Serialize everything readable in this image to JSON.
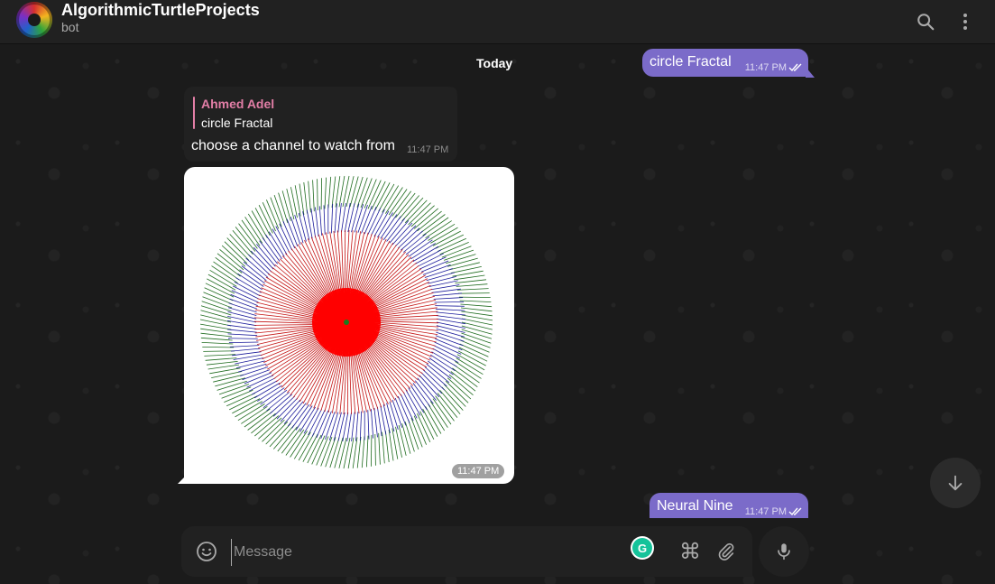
{
  "header": {
    "title": "AlgorithmicTurtleProjects",
    "subtitle": "bot",
    "search_icon": "search-icon",
    "menu_icon": "more-vertical-icon"
  },
  "chat": {
    "date_label": "Today",
    "messages": [
      {
        "type": "outgoing",
        "text": "circle Fractal",
        "time": "11:47 PM"
      },
      {
        "type": "incoming",
        "reply_to": {
          "author": "Ahmed Adel",
          "text": "circle Fractal"
        },
        "text": "choose a channel to watch from",
        "time": "11:47 PM"
      },
      {
        "type": "incoming-image",
        "time": "11:47 PM"
      },
      {
        "type": "outgoing",
        "text": "Neural Nine",
        "time": "11:47 PM"
      }
    ]
  },
  "composer": {
    "placeholder": "Message",
    "grammarly_label": "G"
  },
  "colors": {
    "accent": "#7b6bc9",
    "reply_name": "#e27ea6",
    "grammarly": "#15c39a"
  }
}
